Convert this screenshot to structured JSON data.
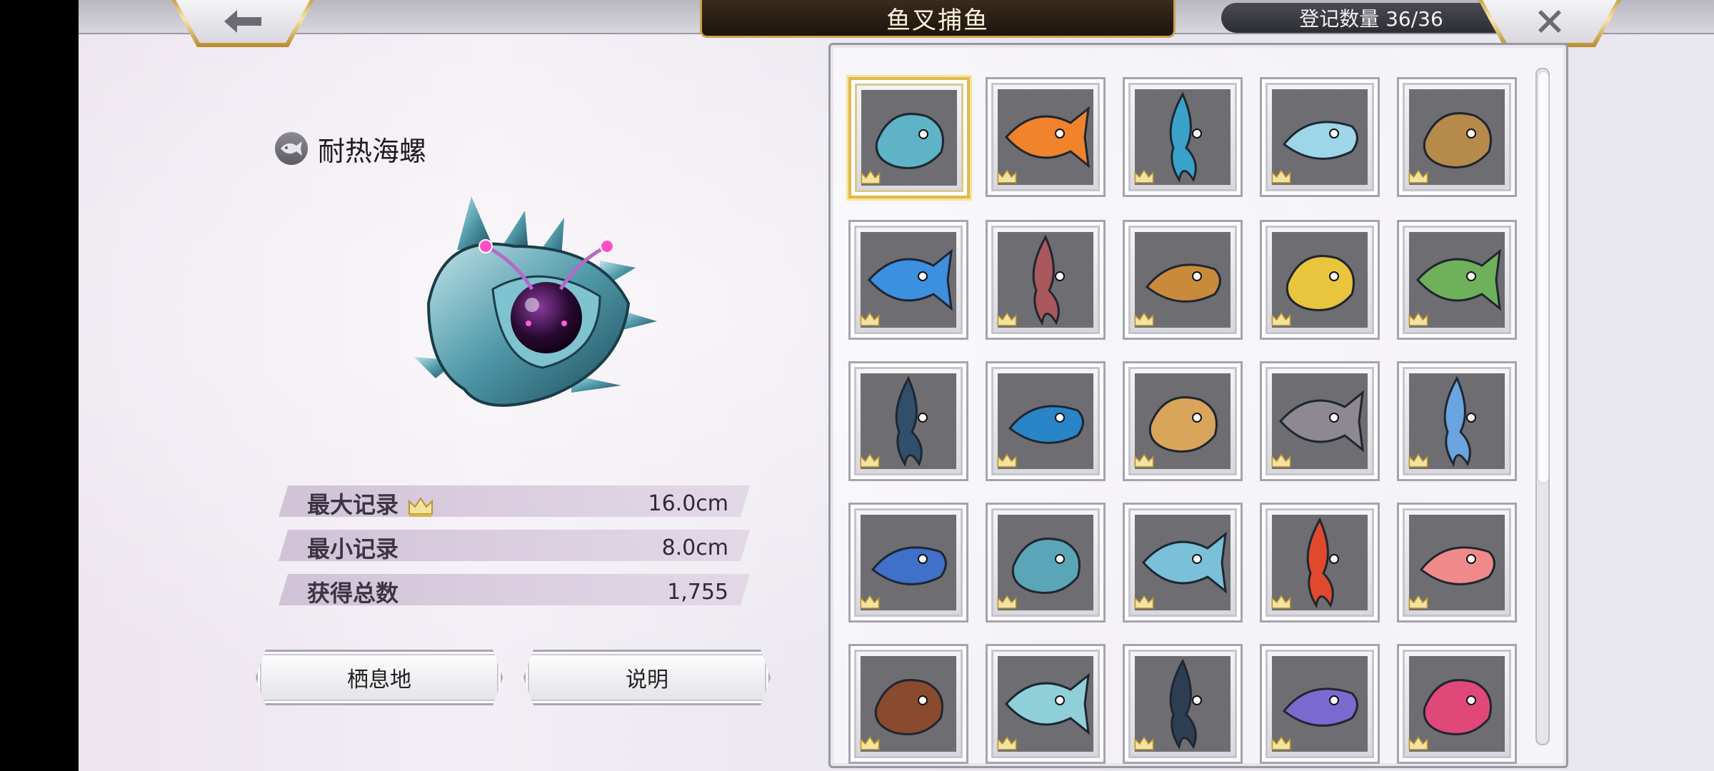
{
  "header": {
    "back_icon": "arrow-left-icon",
    "title": "鱼叉捕鱼",
    "registered_count": "登记数量 36/36",
    "close_icon": "close-x-icon"
  },
  "detail": {
    "fish_name": "耐热海螺",
    "name_icon": "fish-badge-icon",
    "stats": [
      {
        "label": "最大记录",
        "value": "16.0cm",
        "icon": "crown-icon"
      },
      {
        "label": "最小记录",
        "value": "8.0cm"
      },
      {
        "label": "获得总数",
        "value": "1,755"
      }
    ],
    "buttons": {
      "habitat": "栖息地",
      "description": "说明"
    }
  },
  "collection": {
    "selected_index": 0,
    "items": [
      {
        "icon": "spiky-conch-icon",
        "color": "#5fb3c6",
        "crowned": true
      },
      {
        "icon": "orange-goldfish-icon",
        "color": "#f0832c",
        "crowned": true
      },
      {
        "icon": "squid-icon",
        "color": "#3aa2c9",
        "crowned": true
      },
      {
        "icon": "sailfish-icon",
        "color": "#9cd6e8",
        "crowned": true
      },
      {
        "icon": "seahorse-icon",
        "color": "#b58a4a",
        "crowned": true
      },
      {
        "icon": "blue-rockfish-icon",
        "color": "#3d8fe0",
        "crowned": true
      },
      {
        "icon": "red-grouper-icon",
        "color": "#a9585e",
        "crowned": true
      },
      {
        "icon": "jellyfish-icon",
        "color": "#c98a3c",
        "crowned": true
      },
      {
        "icon": "bannerfish-icon",
        "color": "#e8c53c",
        "crowned": true
      },
      {
        "icon": "seaweed-icon",
        "color": "#6fb05a",
        "crowned": true
      },
      {
        "icon": "dark-grouper-icon",
        "color": "#2f4f6a",
        "crowned": true
      },
      {
        "icon": "blue-eel-icon",
        "color": "#2a84c8",
        "crowned": true
      },
      {
        "icon": "anglerfish-icon",
        "color": "#d9a55a",
        "crowned": true
      },
      {
        "icon": "hermit-crab-icon",
        "color": "#8d8891",
        "crowned": true
      },
      {
        "icon": "blue-flounder-icon",
        "color": "#6aa5e0",
        "crowned": true
      },
      {
        "icon": "blue-octopus-icon",
        "color": "#4070c8",
        "crowned": true
      },
      {
        "icon": "spider-crab-icon",
        "color": "#5aa6b8",
        "crowned": true
      },
      {
        "icon": "orb-jellyfish-icon",
        "color": "#7ac0d8",
        "crowned": true
      },
      {
        "icon": "red-coral-icon",
        "color": "#e0492e",
        "crowned": true
      },
      {
        "icon": "pink-sea-slug-icon",
        "color": "#f08a8a",
        "crowned": true
      },
      {
        "icon": "moray-eel-icon",
        "color": "#8a4a2e",
        "crowned": true
      },
      {
        "icon": "sunfish-icon",
        "color": "#8fd0d8",
        "crowned": true
      },
      {
        "icon": "dark-shark-icon",
        "color": "#2e3e52",
        "crowned": true
      },
      {
        "icon": "purple-fish-icon",
        "color": "#7a6ad0",
        "crowned": true
      },
      {
        "icon": "pink-fish-pair-icon",
        "color": "#e0487a",
        "crowned": true
      }
    ]
  },
  "colors": {
    "accent_gold": "#e1b84c",
    "slot_gray": "#6e6d72"
  }
}
